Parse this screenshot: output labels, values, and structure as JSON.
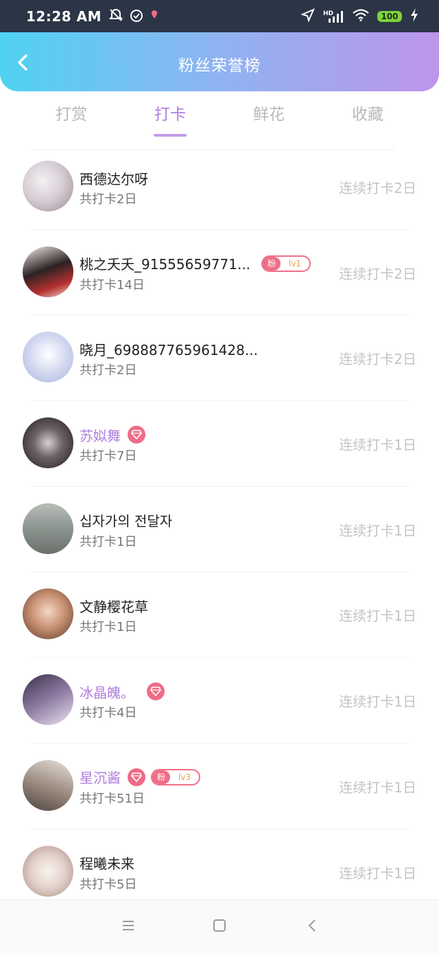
{
  "status_bar": {
    "time": "12:28 AM",
    "battery": "100",
    "hd": "HD"
  },
  "header": {
    "title": "粉丝荣誉榜"
  },
  "tabs": [
    {
      "label": "打赏",
      "active": false
    },
    {
      "label": "打卡",
      "active": true
    },
    {
      "label": "鲜花",
      "active": false
    },
    {
      "label": "收藏",
      "active": false
    }
  ],
  "fans": [
    {
      "name": "西德达尔呀",
      "total": "共打卡2日",
      "streak": "连续打卡2日",
      "vip": false,
      "diamond": false,
      "badge": null
    },
    {
      "name": "桃之夭夭_91555659771...",
      "total": "共打卡14日",
      "streak": "连续打卡2日",
      "vip": false,
      "diamond": false,
      "badge": {
        "tag": "粉",
        "level": "lv1"
      }
    },
    {
      "name": "晓月_698887765961428...",
      "total": "共打卡2日",
      "streak": "连续打卡2日",
      "vip": false,
      "diamond": false,
      "badge": null
    },
    {
      "name": "苏姒舞",
      "total": "共打卡7日",
      "streak": "连续打卡1日",
      "vip": true,
      "diamond": true,
      "badge": null
    },
    {
      "name": "십자가의 전달자",
      "total": "共打卡1日",
      "streak": "连续打卡1日",
      "vip": false,
      "diamond": false,
      "badge": null
    },
    {
      "name": "文静樱花草",
      "total": "共打卡1日",
      "streak": "连续打卡1日",
      "vip": false,
      "diamond": false,
      "badge": null
    },
    {
      "name": "冰晶魄。",
      "total": "共打卡4日",
      "streak": "连续打卡1日",
      "vip": true,
      "diamond": true,
      "badge": null
    },
    {
      "name": "星沉酱",
      "total": "共打卡51日",
      "streak": "连续打卡1日",
      "vip": true,
      "diamond": true,
      "badge": {
        "tag": "粉",
        "level": "lv3"
      }
    },
    {
      "name": "程曦未来",
      "total": "共打卡5日",
      "streak": "连续打卡1日",
      "vip": false,
      "diamond": false,
      "badge": null
    }
  ],
  "colors": {
    "accent": "#b07ce0",
    "badge": "#ee6f86",
    "header_from": "#4fd2f2",
    "header_to": "#bd95ea"
  }
}
